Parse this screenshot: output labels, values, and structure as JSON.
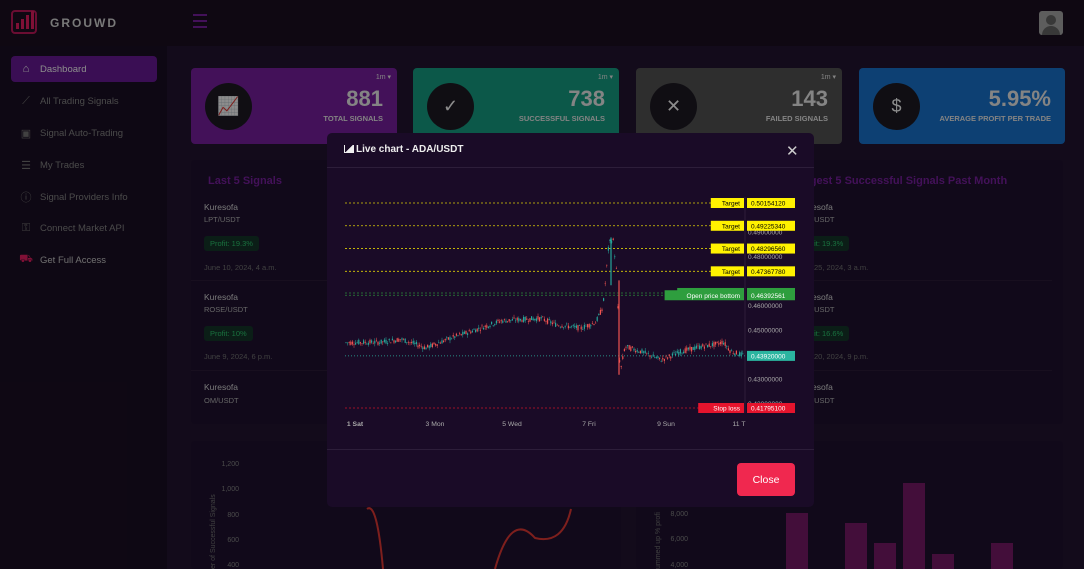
{
  "app": {
    "brand": "GROUWD"
  },
  "sidebar": {
    "items": [
      {
        "label": "Dashboard",
        "icon": "home-icon"
      },
      {
        "label": "All Trading Signals",
        "icon": "chart-line-icon"
      },
      {
        "label": "Signal Auto-Trading",
        "icon": "robot-icon"
      },
      {
        "label": "My Trades",
        "icon": "list-icon"
      },
      {
        "label": "Signal Providers Info",
        "icon": "info-icon"
      },
      {
        "label": "Connect Market API",
        "icon": "key-icon"
      },
      {
        "label": "Get Full Access",
        "icon": "cart-icon"
      }
    ]
  },
  "stats": [
    {
      "value": "881",
      "label": "TOTAL SIGNALS",
      "timeframe": "1m ▾",
      "color": "#7b1fa2",
      "icon": "chart-icon"
    },
    {
      "value": "738",
      "label": "SUCCESSFUL SIGNALS",
      "timeframe": "1m ▾",
      "color": "#16a085",
      "icon": "check-icon"
    },
    {
      "value": "143",
      "label": "FAILED SIGNALS",
      "timeframe": "1m ▾",
      "color": "#555555",
      "icon": "x-icon"
    },
    {
      "value": "5.95%",
      "label": "AVERAGE PROFIT PER TRADE",
      "timeframe": "",
      "color": "#1976d2",
      "icon": "dollar-icon"
    }
  ],
  "last_signals": {
    "title": "Last 5 Signals",
    "items": [
      {
        "name": "Kuresofa",
        "pair": "LPT/USDT",
        "profit": "Profit: 19.3%",
        "date": "June 10, 2024, 4 a.m."
      },
      {
        "name": "Kuresofa",
        "pair": "ROSE/USDT",
        "profit": "Profit: 10%",
        "date": "June 9, 2024, 6 p.m."
      },
      {
        "name": "Kuresofa",
        "pair": "OM/USDT"
      }
    ]
  },
  "biggest_signals": {
    "title": "ggest 5 Successful Signals Past Month",
    "items": [
      {
        "name": "esofa",
        "pair": "/USDT",
        "profit": "fit: 19.3%",
        "date": "25, 2024, 3 a.m."
      },
      {
        "name": "esofa",
        "pair": "/USDT",
        "profit": "fit: 16.6%",
        "date": "20, 2024, 9 p.m."
      },
      {
        "name": "esofa",
        "pair": "/USDT"
      }
    ]
  },
  "bg_chart_left": {
    "yticks": [
      "1,200",
      "1,000",
      "800",
      "600",
      "400"
    ],
    "ylabel": "er of Successful Signals"
  },
  "bg_chart_right": {
    "yticks": [
      "8,000",
      "6,000",
      "4,000"
    ],
    "ylabel": "ummed up % profi"
  },
  "modal": {
    "title": "Live chart - ADA/USDT",
    "close_label": "Close",
    "levels": [
      {
        "tag": "Target",
        "price": "0.50154120"
      },
      {
        "tag": "Target",
        "price": "0.49225340"
      },
      {
        "tag": "Target",
        "price": "0.48296560"
      },
      {
        "tag": "Target",
        "price": "0.47367780"
      },
      {
        "tag": "Open price top",
        "price": "0.46485439"
      },
      {
        "tag": "Open price bottom",
        "price": "0.46392561"
      },
      {
        "tag": "Stop loss",
        "price": "0.41795100"
      }
    ],
    "current_price": "0.43920000",
    "axis_prices": [
      "0.46000000",
      "0.45000000",
      "0.43000000"
    ],
    "partial_axis_prices": [
      "0.49000000",
      "0.48000000",
      "0.42000000"
    ],
    "x_labels": [
      "1 Sat",
      "3 Mon",
      "5 Wed",
      "7 Fri",
      "9 Sun",
      "11 T"
    ]
  },
  "colors": {
    "target": "#fff200",
    "open": "#2e9e3e",
    "stop": "#e5142d",
    "current": "#2bb5a0",
    "accent": "#7b1fa2"
  }
}
